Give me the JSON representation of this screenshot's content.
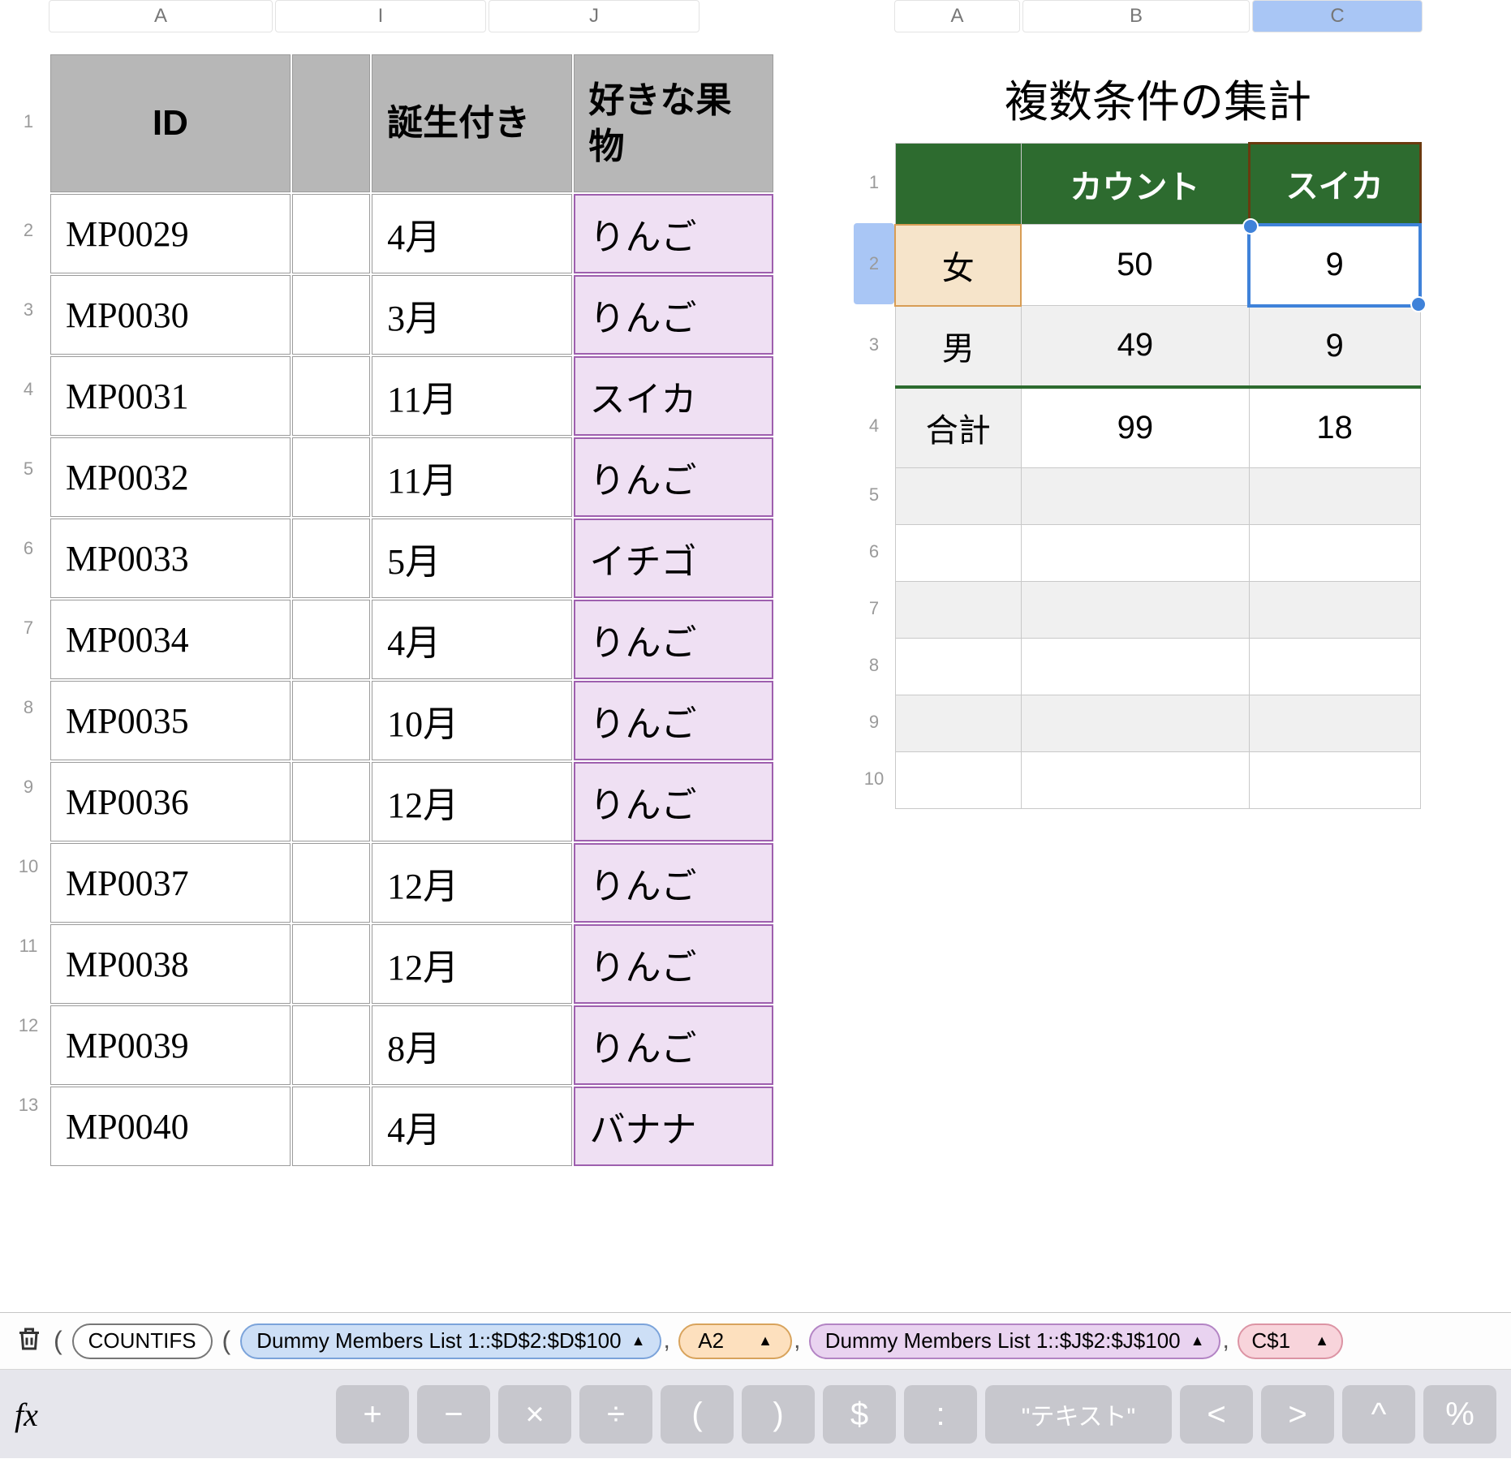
{
  "left": {
    "colHeaders": [
      "A",
      "I",
      "J"
    ],
    "headers": {
      "id": "ID",
      "narrow": "",
      "birth": "誕生付き",
      "fruit": "好きな果物"
    },
    "rows": [
      {
        "id": "MP0029",
        "birth": "4月",
        "fruit": "りんご"
      },
      {
        "id": "MP0030",
        "birth": "3月",
        "fruit": "りんご"
      },
      {
        "id": "MP0031",
        "birth": "11月",
        "fruit": "スイカ"
      },
      {
        "id": "MP0032",
        "birth": "11月",
        "fruit": "りんご"
      },
      {
        "id": "MP0033",
        "birth": "5月",
        "fruit": "イチゴ"
      },
      {
        "id": "MP0034",
        "birth": "4月",
        "fruit": "りんご"
      },
      {
        "id": "MP0035",
        "birth": "10月",
        "fruit": "りんご"
      },
      {
        "id": "MP0036",
        "birth": "12月",
        "fruit": "りんご"
      },
      {
        "id": "MP0037",
        "birth": "12月",
        "fruit": "りんご"
      },
      {
        "id": "MP0038",
        "birth": "12月",
        "fruit": "りんご"
      },
      {
        "id": "MP0039",
        "birth": "8月",
        "fruit": "りんご"
      },
      {
        "id": "MP0040",
        "birth": "4月",
        "fruit": "バナナ"
      }
    ]
  },
  "right": {
    "colHeaders": [
      "A",
      "B",
      "C"
    ],
    "title": "複数条件の集計",
    "headers": {
      "blank": "",
      "count": "カウント",
      "fruit": "スイカ"
    },
    "rows": [
      {
        "label": "女",
        "count": "50",
        "fruit": "9",
        "cls": "femalerow",
        "selected": true
      },
      {
        "label": "男",
        "count": "49",
        "fruit": "9",
        "cls": "malerow"
      },
      {
        "label": "合計",
        "count": "99",
        "fruit": "18",
        "cls": "totalrow"
      }
    ],
    "rowNumbers": [
      "1",
      "2",
      "3",
      "4",
      "5",
      "6",
      "7",
      "8",
      "9",
      "10"
    ]
  },
  "formula": {
    "fn": "COUNTIFS",
    "tokens": [
      {
        "text": "Dummy Members List 1::$D$2:$D$100",
        "cls": "blue"
      },
      {
        "text": "A2",
        "cls": "orange"
      },
      {
        "text": "Dummy Members List 1::$J$2:$J$100",
        "cls": "purple"
      },
      {
        "text": "C$1",
        "cls": "pink"
      }
    ],
    "ops": [
      "+",
      "−",
      "×",
      "÷",
      "(",
      ")",
      "$",
      ":"
    ],
    "textOp": "\"テキスト\"",
    "ops2": [
      "<",
      ">",
      "^",
      "%"
    ],
    "fx": "fx",
    "tri": "▲",
    "comma": ","
  }
}
